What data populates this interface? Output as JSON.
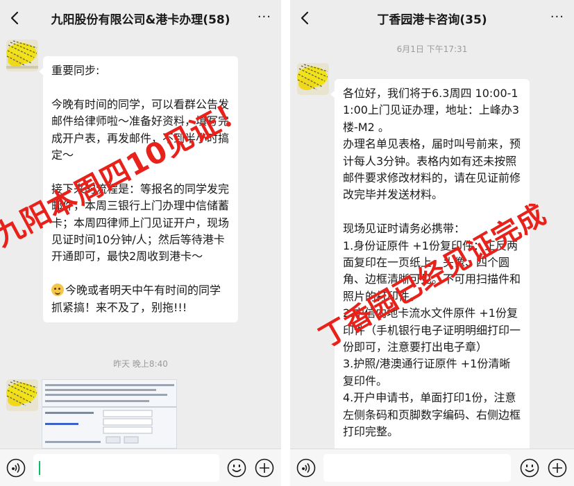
{
  "left": {
    "title": "九阳股份有限公司&港卡办理(58)",
    "more_label": "···",
    "message1": {
      "lines": [
        "重要同步:",
        "",
        "今晚有时间的同学，可以看群公告发邮件给律师啦～准备好资料，填写完成开户表，再发邮件，不到半小时搞定～",
        "",
        "接下来的流程是：等报名的同学发完邮件，本周三银行上门办理中信储蓄卡；本周四律师上门见证开户，现场见证时间10分钟/人；然后等待港卡开通即可，最快2周收到港卡～"
      ],
      "last_line": "今晚或者明天中午有时间的同学抓紧搞！来不及了，别拖!!!"
    },
    "timestamp": "昨天 晚上8:40",
    "watermark": "九阳本周四10见证！",
    "thumb_rows": [
      "添加",
      "删除",
      "中国",
      "香港",
      "确认"
    ]
  },
  "right": {
    "title": "丁香园港卡咨询(35)",
    "more_label": "···",
    "timestamp": "6月1日 下午17:31",
    "message1": {
      "lines": [
        "各位好，我们将于6.3周四 10:00-11:00上门见证办理，地址：上峰办3楼-M2 。",
        "办理名单见表格，届时叫号前来，预计每人3分钟。表格内如有还未按照邮件要求修改材料的，请在见证前修改完毕并发送材料。",
        "",
        "现场见证时请务必携带：",
        "1.身份证原件 +1份复印件：正反两面复印在一页纸上，头像、四个圆角、边框清晰可见。不可用扫描件和照片的打印件。",
        "2.中信内地卡流水文件原件 +1份复印件（手机银行电子证明明细打印一份即可，注意要打出电子章）",
        "3.护照/港澳通行证原件 +1份清晰复印件。",
        "4.开户申请书，单面打印1份，注意左侧条码和页脚数字编码、右侧边框打印完整。"
      ]
    },
    "watermark": "丁香园已经见证完成"
  },
  "colors": {
    "chat_bg": "#ededed",
    "bubble_bg": "#ffffff",
    "watermark": "#e8211b",
    "caret": "#07c160",
    "avatar_yellow": "#f2e21a"
  },
  "icons": {
    "back": "chevron-left-icon",
    "more": "more-dots-icon",
    "voice": "voice-icon",
    "emoji": "emoji-icon",
    "plus": "plus-icon"
  }
}
